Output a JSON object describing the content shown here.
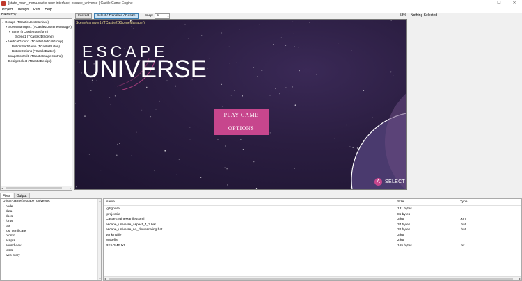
{
  "window": {
    "title": "[state_main_menu.castle-user-interface] escape_universe | Castle Game Engine",
    "minimize": "—",
    "maximize": "☐",
    "close": "✕"
  },
  "menu": [
    "Project",
    "Design",
    "Run",
    "Help"
  ],
  "hierarchy": {
    "label": "Hierarchy",
    "items": [
      {
        "label": "Group1 (TCastleUserInterface)",
        "expander": "▾",
        "depth": 0
      },
      {
        "label": "SceneManager1 (TCastle2DSceneManager)",
        "expander": "▾",
        "depth": 1
      },
      {
        "label": "Items (TCastleTransform)",
        "expander": "▾",
        "depth": 2
      },
      {
        "label": "Scene1 (TCastle2DScene)",
        "expander": "",
        "depth": 3
      },
      {
        "label": "VerticalGroup1 (TCastleVerticalGroup)",
        "expander": "▾",
        "depth": 1
      },
      {
        "label": "ButtonStartGame (TCastleButton)",
        "expander": "",
        "depth": 2
      },
      {
        "label": "ButtonOptions (TCastleButton)",
        "expander": "",
        "depth": 2
      },
      {
        "label": "ImageControl1 (TCastleImageControl)",
        "expander": "",
        "depth": 1
      },
      {
        "label": "DesignSelect (TCastleDesign)",
        "expander": "",
        "depth": 1
      }
    ]
  },
  "toolbar": {
    "interact_label": "Interact",
    "select_label": "Select / Translate / Resize",
    "snap_label": "Snap:",
    "snap_value": "5",
    "spinner": "⬍",
    "zoom": "58%",
    "selection_status": "Nothing Selected"
  },
  "viewport": {
    "label": "SceneManager1 (TCastle2DSceneManager)",
    "logo_top": "ESCAPE",
    "logo_bottom": "UNIVERSE",
    "play_button": "PLAY GAME",
    "options_button": "OPTIONS",
    "a_glyph": "A",
    "select_hint": "SELECT"
  },
  "tabs": [
    "Files",
    "Output"
  ],
  "files_tree": {
    "root": "D:\\cat-games\\escape_universe\\",
    "items": [
      {
        "label": "code",
        "expander": "›"
      },
      {
        "label": "data",
        "expander": "›"
      },
      {
        "label": "docs",
        "expander": "›"
      },
      {
        "label": "fonts",
        "expander": "›"
      },
      {
        "label": "gfx",
        "expander": "›"
      },
      {
        "label": "ios_certificate",
        "expander": "›"
      },
      {
        "label": "promo",
        "expander": "›"
      },
      {
        "label": "scripts",
        "expander": "›"
      },
      {
        "label": "sound-dev",
        "expander": "›"
      },
      {
        "label": "tests",
        "expander": "›"
      },
      {
        "label": "web-story",
        "expander": "›"
      }
    ]
  },
  "files_list": {
    "columns": [
      "Name",
      "Size",
      "Type"
    ],
    "rows": [
      {
        "name": ".gitignore",
        "size": "131 bytes",
        "type": ""
      },
      {
        "name": ".projectile",
        "size": "85 bytes",
        "type": ""
      },
      {
        "name": "CastleEngineManifest.xml",
        "size": "3 kB",
        "type": ".xml"
      },
      {
        "name": "escape_universe_aspect_4_3.bat",
        "size": "34 bytes",
        "type": ".bat"
      },
      {
        "name": "escape_universe_no_downscaling.bat",
        "size": "32 bytes",
        "type": ".bat"
      },
      {
        "name": "Jenkinsfile",
        "size": "3 kB",
        "type": ""
      },
      {
        "name": "Makefile",
        "size": "2 kB",
        "type": ""
      },
      {
        "name": "README.txt",
        "size": "165 bytes",
        "type": ".txt"
      }
    ]
  },
  "scrollbars": {
    "left": "◂",
    "right": "▸",
    "up": "▴",
    "down": "▾"
  },
  "colors": {
    "accent_pink": "#c7468d",
    "viewport_bg": "#2a1d40",
    "viewport_label": "#e8d98c",
    "planet": "#4a3a6e"
  }
}
